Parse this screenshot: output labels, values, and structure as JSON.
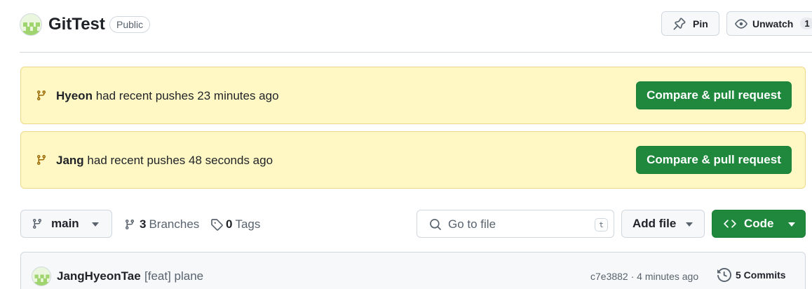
{
  "repo": {
    "name": "GitTest",
    "visibility": "Public",
    "pin_label": "Pin",
    "watch_label": "Unwatch",
    "watch_count": "1"
  },
  "banners": [
    {
      "user": "Hyeon",
      "text": " had recent pushes 23 minutes ago",
      "button_label": "Compare & pull request"
    },
    {
      "user": "Jang",
      "text": " had recent pushes 48 seconds ago",
      "button_label": "Compare & pull request"
    }
  ],
  "toolbar": {
    "branch": "main",
    "branches_count": "3",
    "branches_label": "Branches",
    "tags_count": "0",
    "tags_label": "Tags",
    "search_placeholder": "Go to file",
    "search_shortcut": "t",
    "add_file_label": "Add file",
    "code_label": "Code"
  },
  "latest_commit": {
    "author": "JangHyeonTae",
    "message": "[feat] plane",
    "meta": "c7e3882 · 4 minutes ago",
    "commits_label": "5 Commits"
  },
  "colors": {
    "primary_button": "#1f883d",
    "banner_bg": "#fff8c5",
    "banner_border": "#eed888",
    "icon_gold": "#9a6700"
  },
  "icons": [
    "pin-icon",
    "eye-icon",
    "git-branch-icon",
    "tag-icon",
    "search-icon",
    "code-icon",
    "history-icon",
    "triangle-down-icon"
  ]
}
